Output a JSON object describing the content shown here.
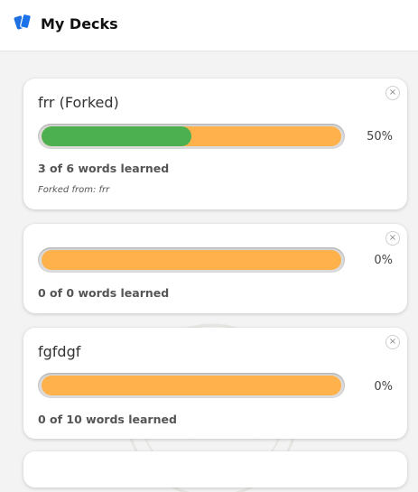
{
  "header": {
    "title": "My Decks"
  },
  "colors": {
    "learned": "#4caf50",
    "unlearned": "#ffb24c",
    "accent": "#1a73e8"
  },
  "decks": [
    {
      "name": "frr (Forked)",
      "delete_label": "×",
      "progress": 0.5,
      "percent_label": "50%",
      "learned_label": "3 of 6 words learned",
      "forked_from": "Forked from: frr"
    },
    {
      "name": "",
      "delete_label": "×",
      "progress": 0,
      "percent_label": "0%",
      "learned_label": "0 of 0 words learned"
    },
    {
      "name": "fgfdgf",
      "delete_label": "×",
      "progress": 0,
      "percent_label": "0%",
      "learned_label": "0 of 10 words learned"
    }
  ]
}
